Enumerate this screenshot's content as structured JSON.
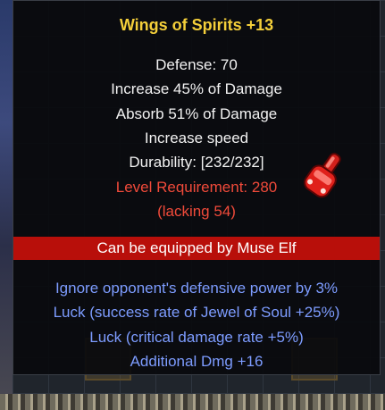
{
  "item": {
    "title": "Wings of Spirits +13",
    "stats": [
      "Defense: 70",
      "Increase 45% of Damage",
      "Absorb 51% of Damage",
      "Increase speed",
      "Durability: [232/232]"
    ],
    "requirement": "Level Requirement: 280",
    "lacking": "(lacking 54)",
    "equip_restriction": "Can be equipped by Muse Elf",
    "excellent_options": [
      "Ignore opponent's defensive power by 3%",
      "Luck (success rate of Jewel of Soul +25%)",
      "Luck (critical damage rate +5%)",
      "Additional Dmg +16"
    ]
  },
  "colors": {
    "title": "#f4cf3a",
    "stat": "#f2f2f2",
    "warning": "#f04a3a",
    "option": "#7d9cff",
    "equip_bar": "#b80f0a"
  },
  "icons": {
    "cursor": "red-gauntlet-cursor-icon"
  }
}
